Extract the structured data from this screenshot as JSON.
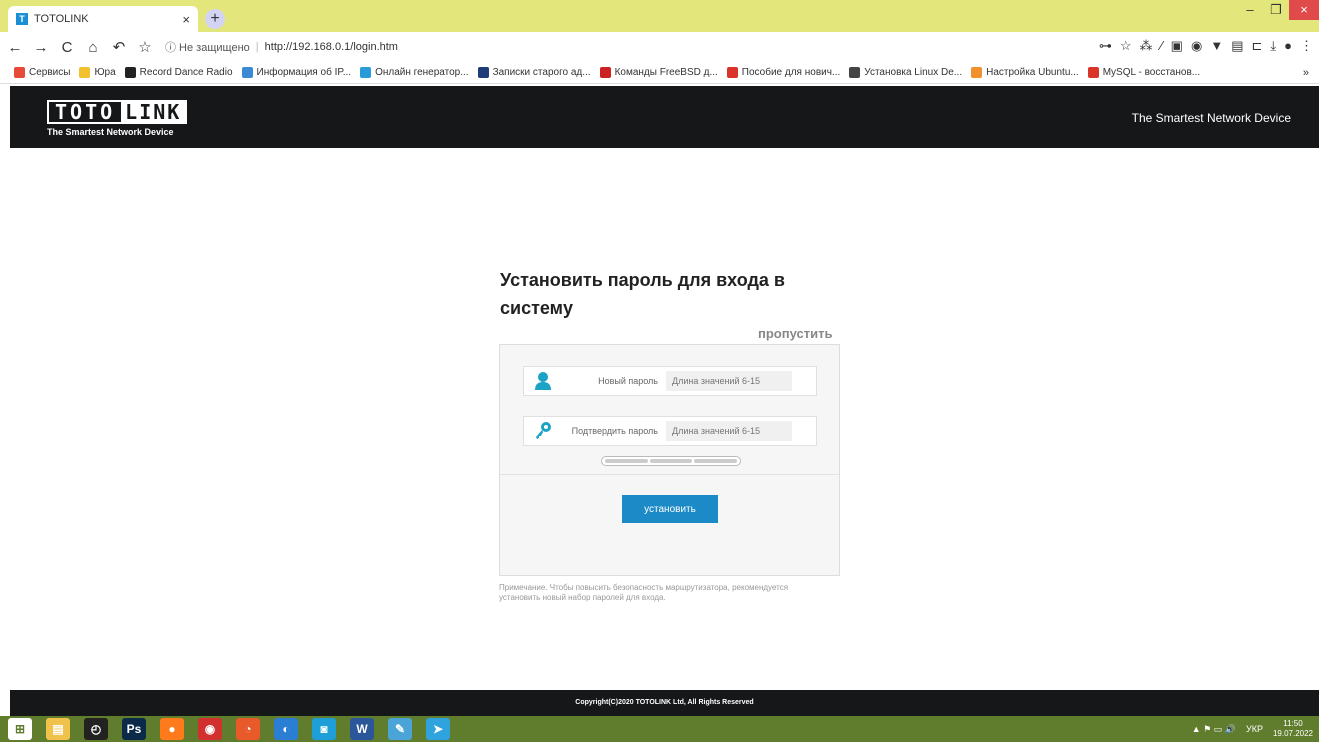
{
  "browser": {
    "tab_title": "TOTOLINK",
    "tab_favicon": "T",
    "close_glyph": "×",
    "new_tab_glyph": "+",
    "insecure_label": "ⓘ Не защищено",
    "url": "http://192.168.0.1/login.htm",
    "win_min": "–",
    "win_max": "❐",
    "win_close": "×",
    "nav": {
      "back": "←",
      "forward": "→",
      "reload": "C",
      "home": "⌂",
      "history": "↶",
      "star": "☆"
    },
    "ext": [
      "⊶",
      "☆",
      "⁂",
      "∕",
      "▣",
      "◉",
      "▼",
      "▤",
      "⊏",
      "⤓",
      "●",
      "⋮"
    ]
  },
  "bookmarks": [
    {
      "label": "Сервисы",
      "color": "#e84a3a"
    },
    {
      "label": "Юра",
      "color": "#f2c12e"
    },
    {
      "label": "Record Dance Radio",
      "color": "#222222"
    },
    {
      "label": "Информация об IP...",
      "color": "#3a8ad6"
    },
    {
      "label": "Онлайн генератор...",
      "color": "#2a9bd9"
    },
    {
      "label": "Записки старого ад...",
      "color": "#1d3c78"
    },
    {
      "label": "Команды FreeBSD д...",
      "color": "#cc2222"
    },
    {
      "label": "Пособие для нович...",
      "color": "#d9332a"
    },
    {
      "label": "Установка Linux De...",
      "color": "#444444"
    },
    {
      "label": "Настройка Ubuntu...",
      "color": "#f0912e"
    },
    {
      "label": "MySQL - восстанов...",
      "color": "#d9332a"
    }
  ],
  "bookmarks_more": "»",
  "header": {
    "logo_toto": "TOTO",
    "logo_link": "LINK",
    "logo_tagline": "The Smartest Network Device",
    "right_text": "The Smartest Network Device"
  },
  "form": {
    "title": "Установить пароль для входа в системy",
    "skip": "пропустить",
    "new_password_label": "Новый пароль",
    "new_password_placeholder": "Длина значений 6-15",
    "confirm_password_label": "Подтвердить пароль",
    "confirm_password_placeholder": "Длина значений 6-15",
    "submit": "установить",
    "note": "Примечание. Чтобы повысить безопасность маршрутизатора, рекомендуется установить новый набор паролей для входа."
  },
  "footer": {
    "copyright": "Copyright(C)2020 TOTOLINK Ltd, All Rights Reserved"
  },
  "taskbar": {
    "apps": [
      {
        "label": "⊞",
        "color": "#ffffff"
      },
      {
        "label": "▤",
        "color": "#f0c24b"
      },
      {
        "label": "◴",
        "color": "#222222"
      },
      {
        "label": "Ps",
        "color": "#0b2a4a"
      },
      {
        "label": "●",
        "color": "#ff7a1a"
      },
      {
        "label": "◉",
        "color": "#d22f2f"
      },
      {
        "label": "◔",
        "color": "#e85a2a"
      },
      {
        "label": "◐",
        "color": "#2a7fd4"
      },
      {
        "label": "◙",
        "color": "#1e9fd8"
      },
      {
        "label": "W",
        "color": "#2b579a"
      },
      {
        "label": "✎",
        "color": "#4aa4d8"
      },
      {
        "label": "➤",
        "color": "#2ea3dd"
      }
    ],
    "tray_icons": "▲ ⚑ ▭ 🔊",
    "language": "УКР",
    "time": "11:50",
    "date": "19.07.2022"
  }
}
